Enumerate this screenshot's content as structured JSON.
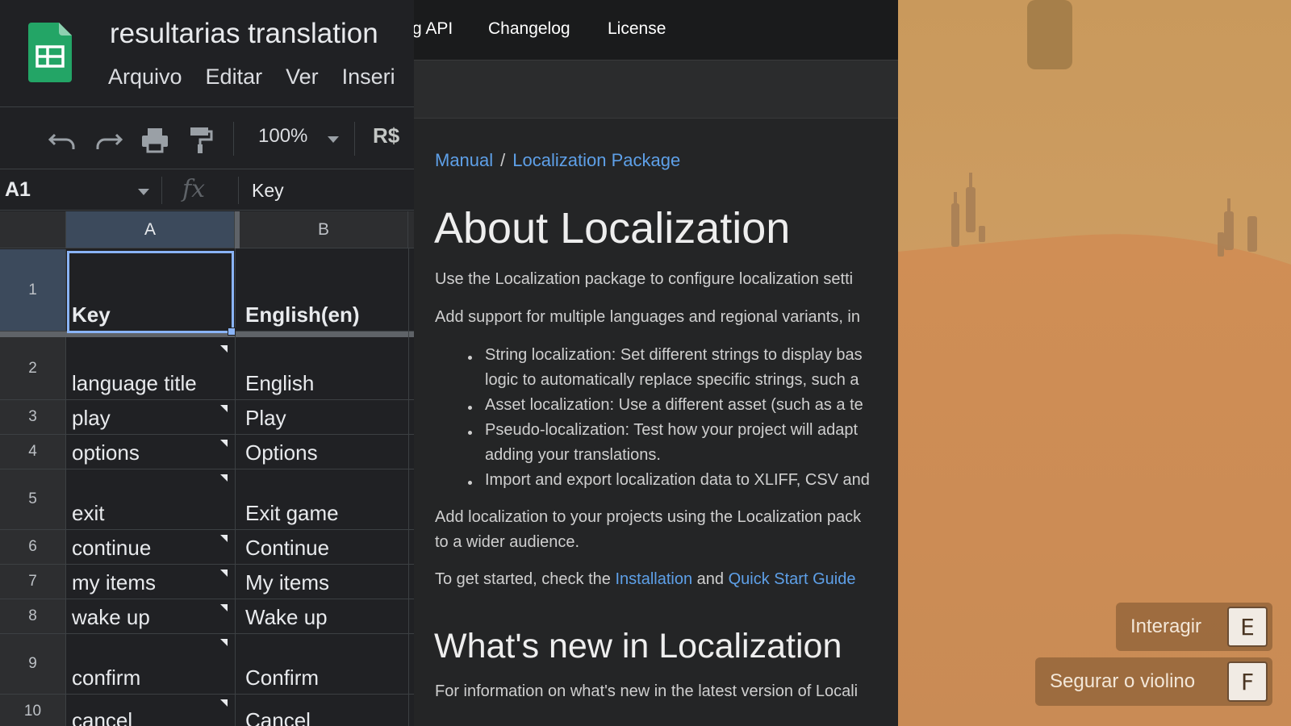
{
  "sheets": {
    "title": "resultarias translation",
    "menu": [
      "Arquivo",
      "Editar",
      "Ver",
      "Inseri"
    ],
    "toolbar": {
      "zoom": "100%",
      "currency": "R$",
      "icons": [
        "undo-icon",
        "redo-icon",
        "print-icon",
        "paint-format-icon"
      ]
    },
    "formula_bar": {
      "cell_ref": "A1",
      "fx": "fx",
      "value": "Key"
    },
    "columns": [
      "A",
      "B"
    ],
    "rows": [
      {
        "num": "1",
        "a": "Key",
        "b": "English(en)"
      },
      {
        "num": "2",
        "a": "language title",
        "b": "English"
      },
      {
        "num": "3",
        "a": "play",
        "b": "Play"
      },
      {
        "num": "4",
        "a": "options",
        "b": "Options"
      },
      {
        "num": "5",
        "a": "exit",
        "b": "Exit game"
      },
      {
        "num": "6",
        "a": "continue",
        "b": "Continue"
      },
      {
        "num": "7",
        "a": "my items",
        "b": "My items"
      },
      {
        "num": "8",
        "a": "wake up",
        "b": "Wake up"
      },
      {
        "num": "9",
        "a": "confirm",
        "b": "Confirm"
      },
      {
        "num": "10",
        "a": "cancel",
        "b": "Cancel"
      }
    ]
  },
  "docs": {
    "nav": [
      "g API",
      "Changelog",
      "License"
    ],
    "breadcrumb": {
      "root": "Manual",
      "sep": "/",
      "current": "Localization Package"
    },
    "title": "About Localization",
    "intro": "Use the Localization package to configure localization setti",
    "support": "Add support for multiple languages and regional variants, in",
    "bullets": [
      [
        "String localization: Set different strings to display bas",
        "logic to automatically replace specific strings, such a"
      ],
      [
        "Asset localization: Use a different asset (such as a te"
      ],
      [
        "Pseudo-localization: Test how your project will adapt",
        "adding your translations."
      ],
      [
        "Import and export localization data to XLIFF, CSV and"
      ]
    ],
    "add_para": [
      "Add localization to your projects using the Localization pack",
      "to a wider audience."
    ],
    "get_started": {
      "prefix": "To get started, check the",
      "link1": "Installation",
      "mid": "and",
      "link2": "Quick Start Guide"
    },
    "whats_new_title": "What's new in Localization",
    "whats_new_text": "For information on what's new in the latest version of Locali"
  },
  "game": {
    "prompts": [
      {
        "label": "Interagir",
        "key": "E"
      },
      {
        "label": "Segurar o violino",
        "key": "F"
      }
    ]
  }
}
